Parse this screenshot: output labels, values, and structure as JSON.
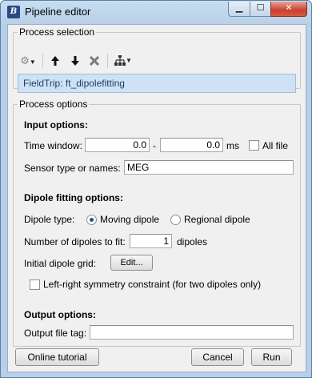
{
  "window": {
    "title": "Pipeline editor",
    "app_icon": "bs"
  },
  "process_selection": {
    "legend": "Process selection",
    "toolbar": [
      {
        "name": "gear-icon",
        "glyph": "⚙▾"
      },
      {
        "name": "arrow-up-icon",
        "glyph": "🠕"
      },
      {
        "name": "arrow-down-icon",
        "glyph": "🠗"
      },
      {
        "name": "delete-icon",
        "glyph": "✖"
      },
      {
        "name": "tree-icon",
        "glyph": "⚘▾"
      }
    ],
    "selected_process": "FieldTrip:  ft_dipolefitting"
  },
  "process_options": {
    "legend": "Process options",
    "input": {
      "heading": "Input options:",
      "time_window_label": "Time window:",
      "time_start": "0.0",
      "dash": "-",
      "time_end": "0.0",
      "unit": "ms",
      "all_file_label": "All file",
      "sensor_label": "Sensor type or names:",
      "sensor_value": "MEG"
    },
    "dipole": {
      "heading": "Dipole fitting options:",
      "type_label": "Dipole type:",
      "moving_label": "Moving dipole",
      "regional_label": "Regional dipole",
      "selected": "moving",
      "count_label": "Number of dipoles to fit:",
      "count_value": "1",
      "count_unit": "dipoles",
      "grid_label": "Initial dipole grid:",
      "edit_label": "Edit...",
      "symmetry_label": "Left-right symmetry constraint (for two dipoles only)"
    },
    "output": {
      "heading": "Output options:",
      "tag_label": "Output file tag:",
      "tag_value": ""
    }
  },
  "buttons": {
    "online_tutorial": "Online tutorial",
    "cancel": "Cancel",
    "run": "Run"
  }
}
